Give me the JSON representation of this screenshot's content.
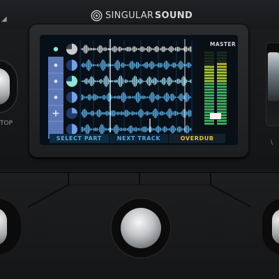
{
  "brand": {
    "name_light": "SINGULAR",
    "name_bold": "SOUND",
    "logo_icon": "singular-sound-logo-icon"
  },
  "left_control": {
    "label": "TOP"
  },
  "right_control": {
    "label": "\\"
  },
  "screen": {
    "rows": 6,
    "part_column": [
      {
        "icon": "dot-icon"
      },
      {
        "icon": "dot-icon"
      },
      {
        "icon": "dot-icon"
      },
      {
        "icon": "dot-icon"
      },
      {
        "icon": "plus-icon"
      },
      {
        "icon": "empty"
      }
    ],
    "track_pies": [
      0.75,
      0.5,
      0.75,
      0.5,
      0.25,
      0.5
    ],
    "master": {
      "label": "MASTER",
      "level_left": 0.82,
      "level_right": 0.84
    },
    "footer": {
      "select": "SELECT PART",
      "next": "NEXT TRACK",
      "overdub": "OVERDUB"
    },
    "colors": {
      "accent_blue": "#5fb0e8",
      "wave_top": "#d7d9db",
      "overdub_yellow": "#e1c23a"
    }
  },
  "footswitches": {
    "count": 3
  }
}
